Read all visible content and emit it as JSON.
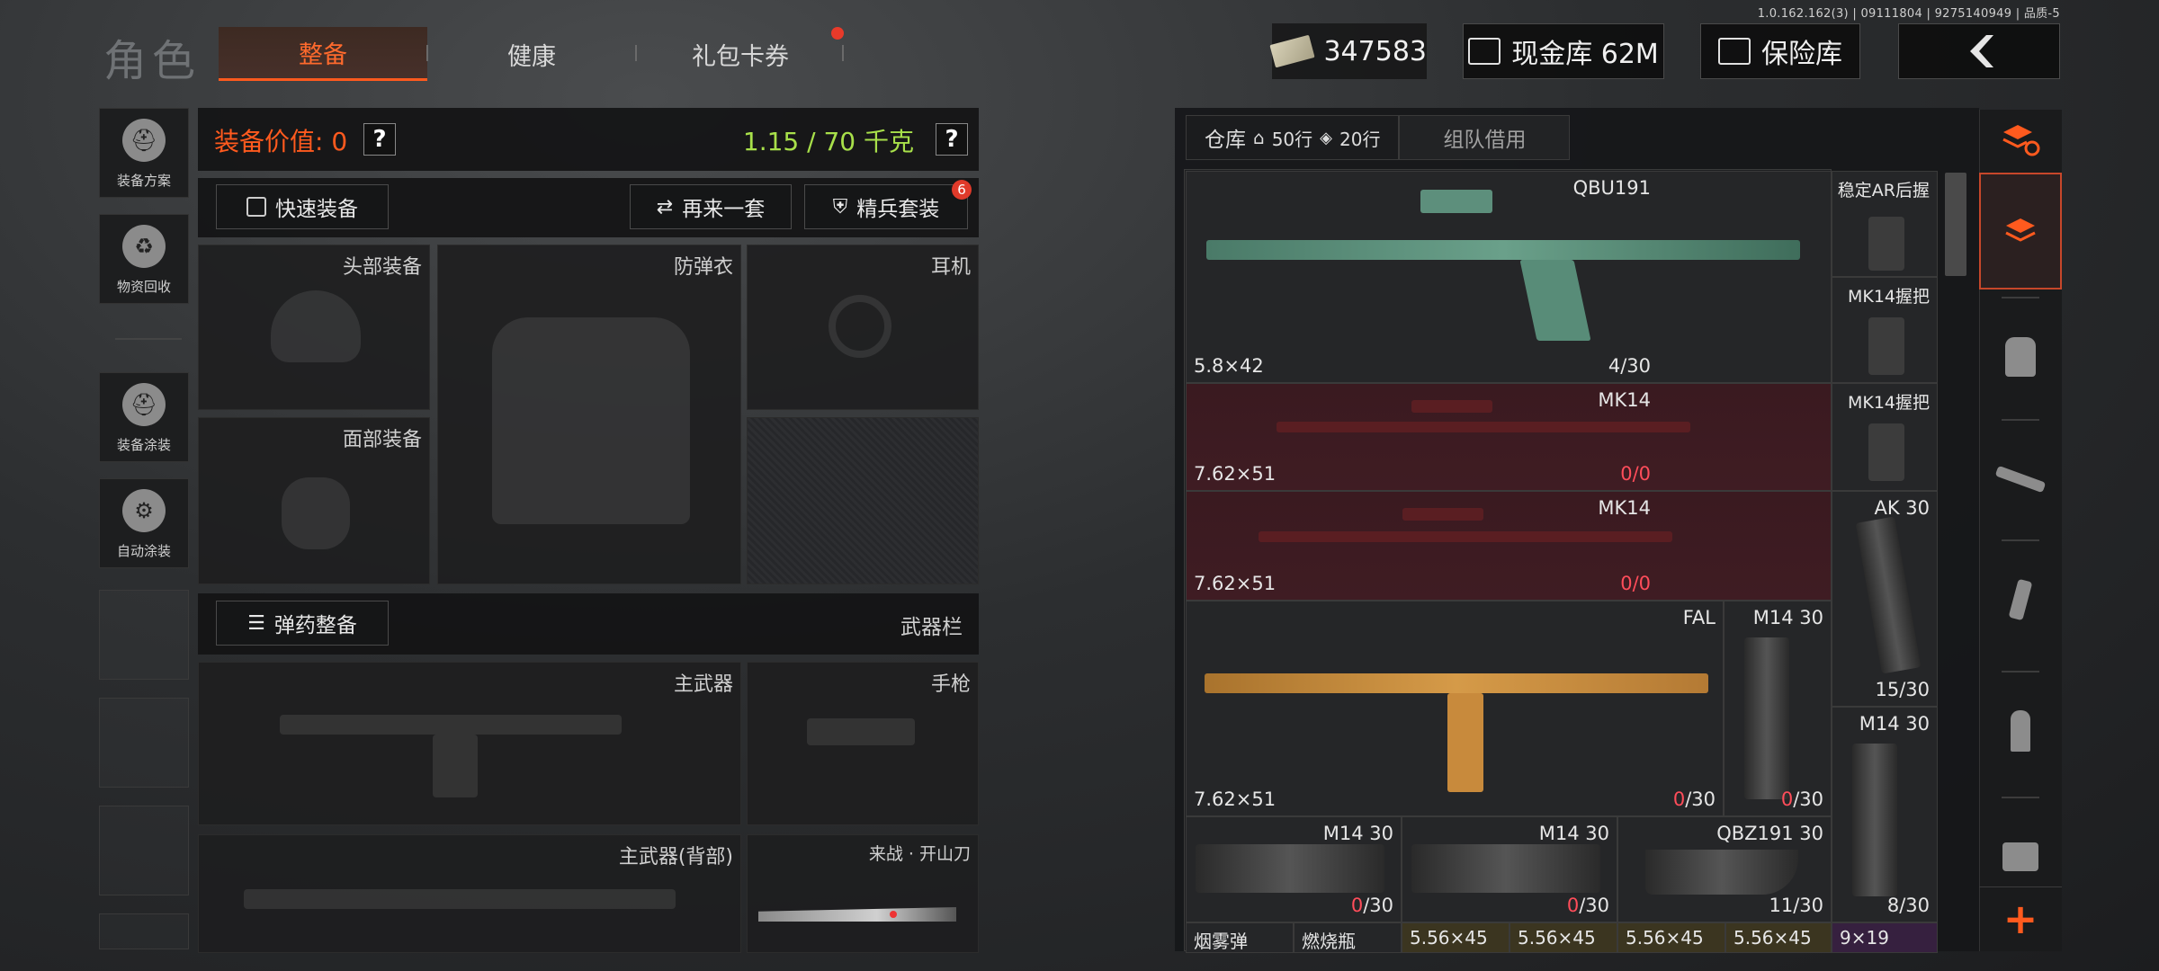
{
  "version": "1.0.162.162(3) | 09111804 | 9275140949 | 品质-5",
  "header": {
    "title": "角色",
    "tabs": [
      {
        "label": "整备",
        "active": true
      },
      {
        "label": "健康",
        "active": false
      },
      {
        "label": "礼包卡券",
        "active": false,
        "badge_dot": true
      }
    ],
    "cash": "347583",
    "cash_vault": "现金库 62M",
    "safe_box": "保险库",
    "back_icon": "chevron-left-icon"
  },
  "sidebar": {
    "items": [
      {
        "label": "装备方案",
        "icon": "helmet-grid-icon"
      },
      {
        "label": "物资回收",
        "icon": "recycle-icon"
      },
      {
        "label": "装备涂装",
        "icon": "helmet-brush-icon"
      },
      {
        "label": "自动涂装",
        "icon": "brush-gear-icon"
      }
    ]
  },
  "equipment": {
    "value_label": "装备价值: 0",
    "weight_label": "1.15 / 70 千克",
    "quick_equip": "快速装备",
    "again": "再来一套",
    "elite_suit": "精兵套装",
    "elite_badge": "6",
    "slots": {
      "head": "头部装备",
      "armor": "防弹衣",
      "headset": "耳机",
      "face": "面部装备",
      "ammo_prep": "弹药整备",
      "weapon_bar": "武器栏",
      "primary": "主武器",
      "pistol": "手枪",
      "primary_back": "主武器(背部)",
      "melee": "来战 · 开山刀"
    }
  },
  "storage": {
    "tab_warehouse": "仓库",
    "rows_home": "50行",
    "rows_ticket": "20行",
    "tab_team": "组队借用",
    "items": [
      {
        "name": "QBU191",
        "caliber": "5.8×42",
        "count_a": "4",
        "count_b": "/30",
        "style": "normal"
      },
      {
        "name": "稳定AR后握",
        "style": "normal"
      },
      {
        "name": "MK14握把",
        "style": "normal"
      },
      {
        "name": "MK14",
        "caliber": "7.62×51",
        "count_a": "0",
        "count_b": "/0",
        "style": "red"
      },
      {
        "name": "MK14握把",
        "style": "normal"
      },
      {
        "name": "MK14",
        "caliber": "7.62×51",
        "count_a": "0",
        "count_b": "/0",
        "style": "red"
      },
      {
        "name": "AK 30",
        "count_a": "15",
        "count_b": "/30",
        "style": "normal"
      },
      {
        "name": "FAL",
        "caliber": "7.62×51",
        "count_a": "0",
        "count_b": "/30",
        "style": "normal"
      },
      {
        "name": "M14 30",
        "count_a": "0",
        "count_b": "/30",
        "style": "normal"
      },
      {
        "name": "M14 30",
        "count_a": "8",
        "count_b": "/30",
        "style": "normal"
      },
      {
        "name": "M14 30",
        "count_a": "0",
        "count_b": "/30",
        "style": "normal"
      },
      {
        "name": "M14 30",
        "count_a": "0",
        "count_b": "/30",
        "style": "normal"
      },
      {
        "name": "QBZ191 30",
        "count_a": "11",
        "count_b": "/30",
        "style": "normal"
      }
    ],
    "bottom_row": [
      {
        "label": "烟雾弹",
        "style": "normal"
      },
      {
        "label": "燃烧瓶",
        "style": "normal"
      },
      {
        "label": "5.56×45",
        "style": "gold"
      },
      {
        "label": "5.56×45",
        "style": "gold"
      },
      {
        "label": "5.56×45",
        "style": "gold"
      },
      {
        "label": "5.56×45",
        "style": "gold"
      },
      {
        "label": "9×19",
        "style": "purple"
      }
    ]
  },
  "sort_bar": {
    "icons": [
      "stack-refresh-icon",
      "layers-icon",
      "vest-icon",
      "rifle-icon",
      "magazine-icon",
      "bullet-icon",
      "scope-icon",
      "plus-icon"
    ]
  },
  "colors": {
    "accent": "#ff5a1e",
    "weight_green": "#a8e04a",
    "zero_red": "#ff4d5a"
  }
}
